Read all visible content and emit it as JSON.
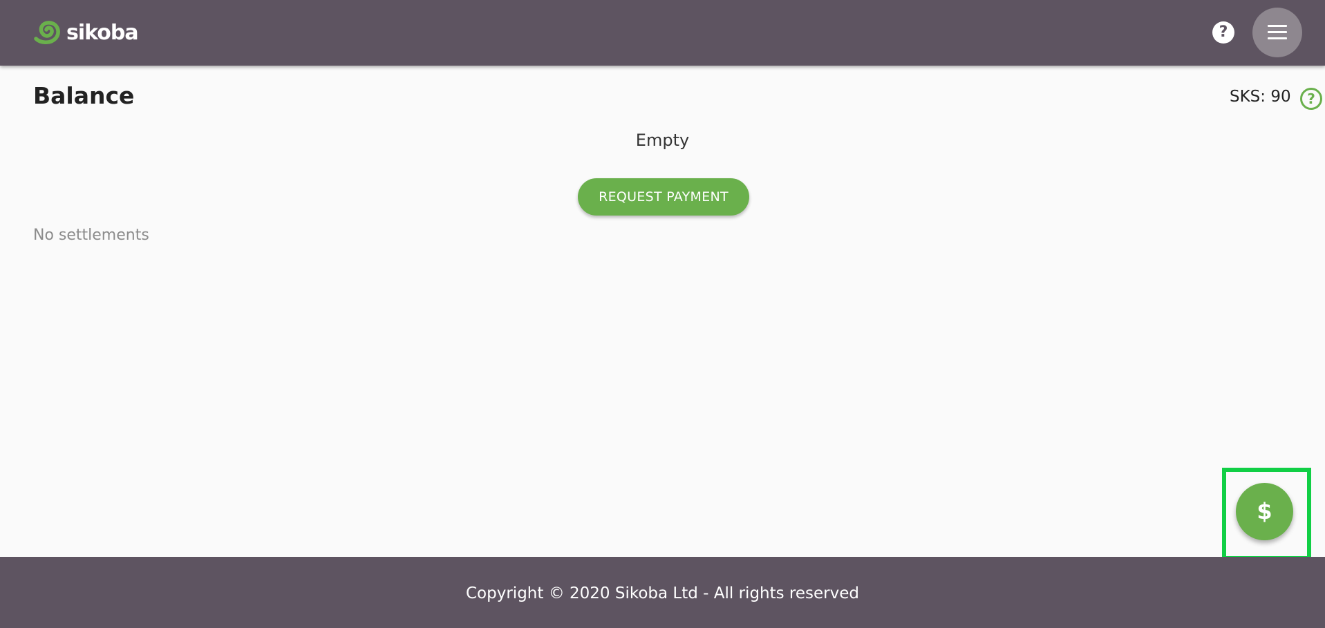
{
  "header": {
    "logo_text": "sikoba",
    "help_icon": "question-circle-icon",
    "help_glyph": "?",
    "menu_icon": "hamburger-menu-icon"
  },
  "balance": {
    "title": "Balance",
    "sks_label": "SKS: 90",
    "sks_help_glyph": "?",
    "empty_text": "Empty",
    "request_payment_label": "REQUEST PAYMENT",
    "no_settlements_text": "No settlements"
  },
  "fab": {
    "icon": "dollar-icon",
    "glyph": "$"
  },
  "footer": {
    "copyright": "Copyright © 2020 Sikoba Ltd - All rights reserved"
  },
  "colors": {
    "header_bg": "#5e5461",
    "accent_green": "#6ab04c",
    "highlight_green": "#11cf45",
    "menu_button_bg": "#8e878f",
    "page_bg": "#fafafa"
  }
}
